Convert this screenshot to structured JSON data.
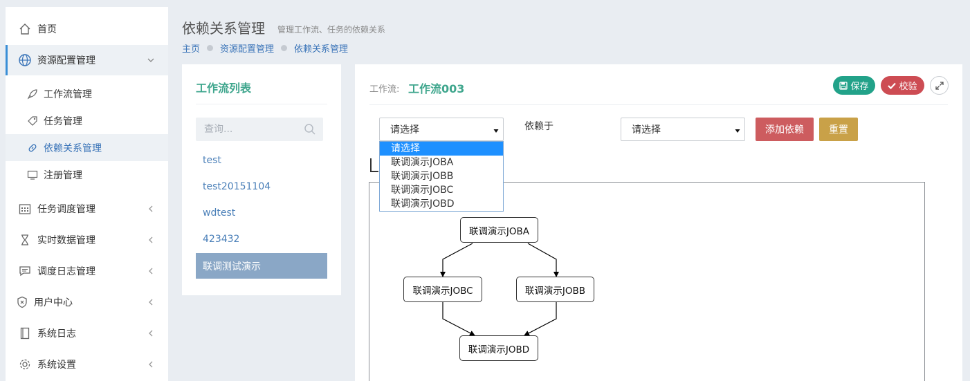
{
  "sidebar": {
    "items": [
      {
        "label": "首页",
        "icon": "home-icon"
      },
      {
        "label": "资源配置管理",
        "icon": "globe-icon"
      },
      {
        "label": "任务调度管理",
        "icon": "calendar-icon"
      },
      {
        "label": "实时数据管理",
        "icon": "hourglass-icon"
      },
      {
        "label": "调度日志管理",
        "icon": "chat-icon"
      },
      {
        "label": "用户中心",
        "icon": "shield-icon"
      },
      {
        "label": "系统日志",
        "icon": "book-icon"
      },
      {
        "label": "系统设置",
        "icon": "gear-icon"
      }
    ],
    "sub_items": [
      {
        "label": "工作流管理",
        "icon": "rocket-icon"
      },
      {
        "label": "任务管理",
        "icon": "tag-icon"
      },
      {
        "label": "依赖关系管理",
        "icon": "link-icon"
      },
      {
        "label": "注册管理",
        "icon": "monitor-icon"
      }
    ]
  },
  "header": {
    "title": "依赖关系管理",
    "subtitle": "管理工作流、任务的依赖关系",
    "breadcrumb": [
      "主页",
      "资源配置管理",
      "依赖关系管理"
    ]
  },
  "workflow_list": {
    "title": "工作流列表",
    "search_placeholder": "查询...",
    "items": [
      "test",
      "test20151104",
      "wdtest",
      "423432",
      "联调测试演示"
    ],
    "selected_index": 4
  },
  "editor": {
    "workflow_label": "工作流:",
    "workflow_name": "工作流003",
    "save_label": "保存",
    "check_label": "校验",
    "select_placeholder": "请选择",
    "depends_label": "依赖于",
    "add_label": "添加依赖",
    "reset_label": "重置",
    "dropdown_options": [
      "请选择",
      "联调演示JOBA",
      "联调演示JOBB",
      "联调演示JOBC",
      "联调演示JOBD"
    ],
    "dropdown_highlighted": 0
  },
  "graph": {
    "nodes": [
      "联调演示JOBA",
      "联调演示JOBC",
      "联调演示JOBB",
      "联调演示JOBD"
    ]
  },
  "colors": {
    "accent_green": "#22a289",
    "title_green": "#3fa68d",
    "danger": "#cd4c53",
    "warning": "#c9a148",
    "link_blue": "#3a74b8",
    "selected_item": "#8aa7c6"
  }
}
